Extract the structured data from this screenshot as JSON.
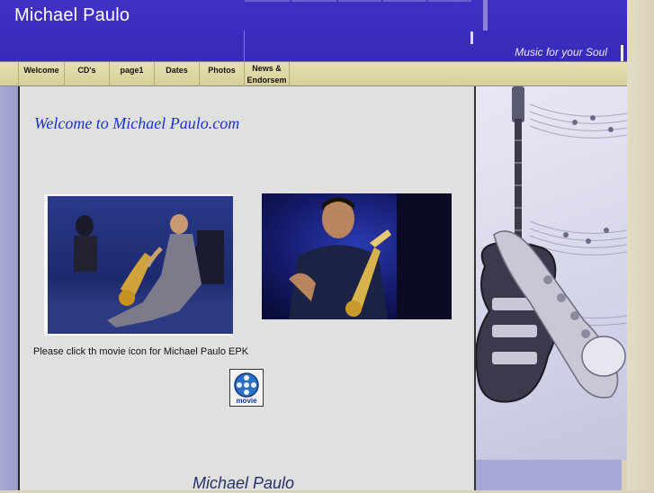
{
  "header": {
    "title": "Michael Paulo",
    "tagline": "Music for your Soul"
  },
  "nav": {
    "items": [
      {
        "label": "Welcome"
      },
      {
        "label": "CD's"
      },
      {
        "label": "page1"
      },
      {
        "label": "Dates"
      },
      {
        "label": "Photos"
      },
      {
        "label": "News & Endorsem"
      }
    ]
  },
  "main": {
    "welcome_heading": "Welcome to Michael Paulo.com",
    "epk_caption": "Please click th movie icon for Michael Paulo EPK",
    "movie_icon_label": "movie",
    "footer_name": "Michael Paulo"
  },
  "colors": {
    "header_bg": "#3a2ab8",
    "nav_bg": "#ddd5a0",
    "heading_blue": "#1a32d8",
    "content_bg": "#e0e0e0"
  },
  "icons": {
    "movie": "film-reel-icon"
  }
}
